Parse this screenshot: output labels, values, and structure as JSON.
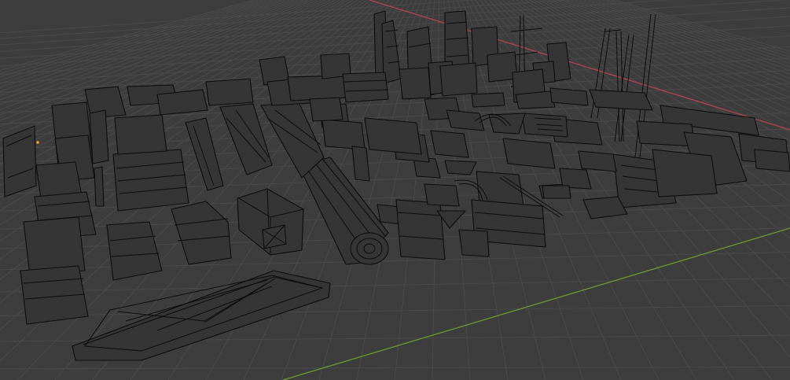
{
  "viewport": {
    "view": "Perspective",
    "shading": "wireframe",
    "grid_floor": true,
    "colors": {
      "background": "#3d3d3d",
      "grid": "#4a4a4a",
      "wire": "#0d0d0d",
      "x_axis": "#b5434d",
      "y_axis": "#6b9a2f",
      "origin": "#f5a623"
    }
  }
}
